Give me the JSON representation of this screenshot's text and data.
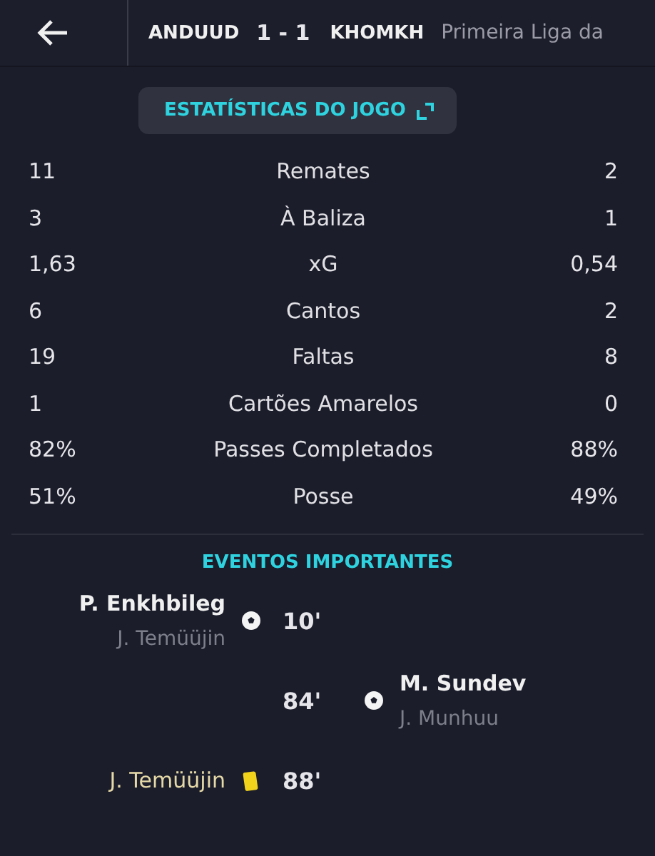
{
  "header": {
    "home": "ANDUUD",
    "score": "1 - 1",
    "away": "KHOMKH",
    "competition": "Primeira Liga da"
  },
  "stats_button": {
    "label": "ESTATÍSTICAS DO JOGO"
  },
  "stats": [
    {
      "home": "11",
      "label": "Remates",
      "away": "2"
    },
    {
      "home": "3",
      "label": "À Baliza",
      "away": "1"
    },
    {
      "home": "1,63",
      "label": "xG",
      "away": "0,54"
    },
    {
      "home": "6",
      "label": "Cantos",
      "away": "2"
    },
    {
      "home": "19",
      "label": "Faltas",
      "away": "8"
    },
    {
      "home": "1",
      "label": "Cartões Amarelos",
      "away": "0"
    },
    {
      "home": "82%",
      "label": "Passes Completados",
      "away": "88%"
    },
    {
      "home": "51%",
      "label": "Posse",
      "away": "49%"
    }
  ],
  "events_title": "EVENTOS IMPORTANTES",
  "events": [
    {
      "kind": "goal",
      "away_team": false,
      "player": "P. Enkhbileg",
      "assist": "J. Temüüjin",
      "minute": "10'"
    },
    {
      "kind": "goal",
      "away_team": true,
      "player": "M. Sundev",
      "assist": "J. Munhuu",
      "minute": "84'"
    },
    {
      "kind": "yellow_card",
      "away_team": false,
      "player": "J. Temüüjin",
      "minute": "88'"
    }
  ]
}
